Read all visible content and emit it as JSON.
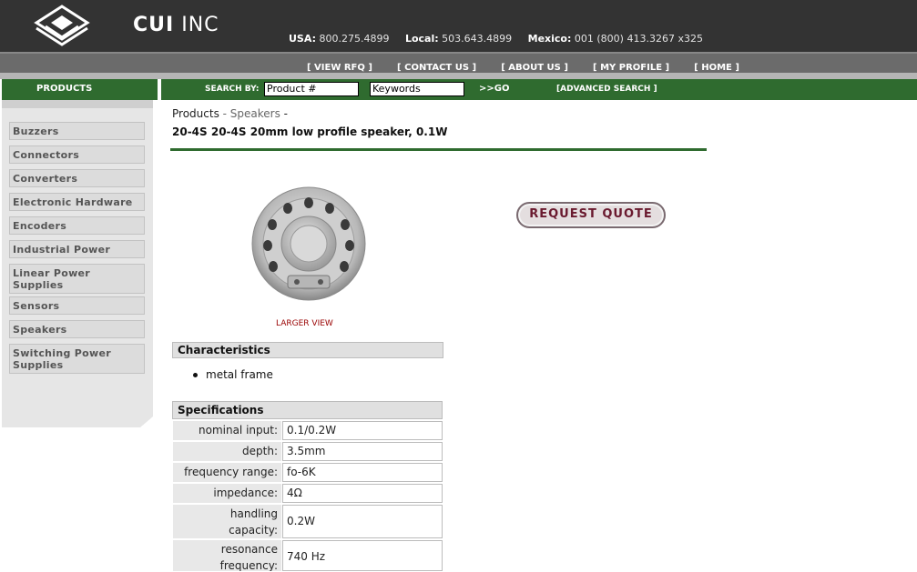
{
  "header": {
    "logo_bold": "CUI",
    "logo_light": "INC",
    "phones": [
      {
        "label": "USA:",
        "value": "800.275.4899"
      },
      {
        "label": "Local:",
        "value": "503.643.4899"
      },
      {
        "label": "Mexico:",
        "value": "001 (800) 413.3267 x325"
      }
    ]
  },
  "nav": {
    "links": [
      "[ VIEW RFQ ]",
      "[ CONTACT US ]",
      "[ ABOUT US ]",
      "[ MY PROFILE ]",
      "[ HOME ]"
    ]
  },
  "search": {
    "products_tab": "PRODUCTS",
    "label": "SEARCH BY:",
    "product_value": "Product #",
    "keywords_value": "Keywords",
    "go": ">>GO",
    "advanced": "[ADVANCED SEARCH ]"
  },
  "sidebar": {
    "items": [
      "Buzzers",
      "Connectors",
      "Converters",
      "Electronic Hardware",
      "Encoders",
      "Industrial Power",
      "Linear Power Supplies",
      "Sensors",
      "Speakers",
      "Switching Power Supplies"
    ]
  },
  "breadcrumb": {
    "root": "Products",
    "sep1": " - ",
    "category": "Speakers",
    "sep2": " -"
  },
  "product": {
    "title": "20-4S 20-4S 20mm low profile speaker, 0.1W",
    "larger_view": "LARGER VIEW",
    "request_quote": "REQUEST QUOTE"
  },
  "characteristics": {
    "heading": "Characteristics",
    "items": [
      "metal frame"
    ]
  },
  "specifications": {
    "heading": "Specifications",
    "rows": [
      {
        "label": "nominal input:",
        "value": "0.1/0.2W"
      },
      {
        "label": "depth:",
        "value": "3.5mm"
      },
      {
        "label": "frequency range:",
        "value": "fo-6K"
      },
      {
        "label": "impedance:",
        "value": "4Ω"
      },
      {
        "label": "handling capacity:",
        "value": "0.2W"
      },
      {
        "label": "resonance frequency:",
        "value": "740 Hz"
      }
    ]
  },
  "colors": {
    "header_bg": "#333333",
    "nav_bg": "#6b6b6b",
    "green_bar": "#2f6b2f",
    "link_red": "#990000",
    "quote_text": "#6a1a2f"
  }
}
